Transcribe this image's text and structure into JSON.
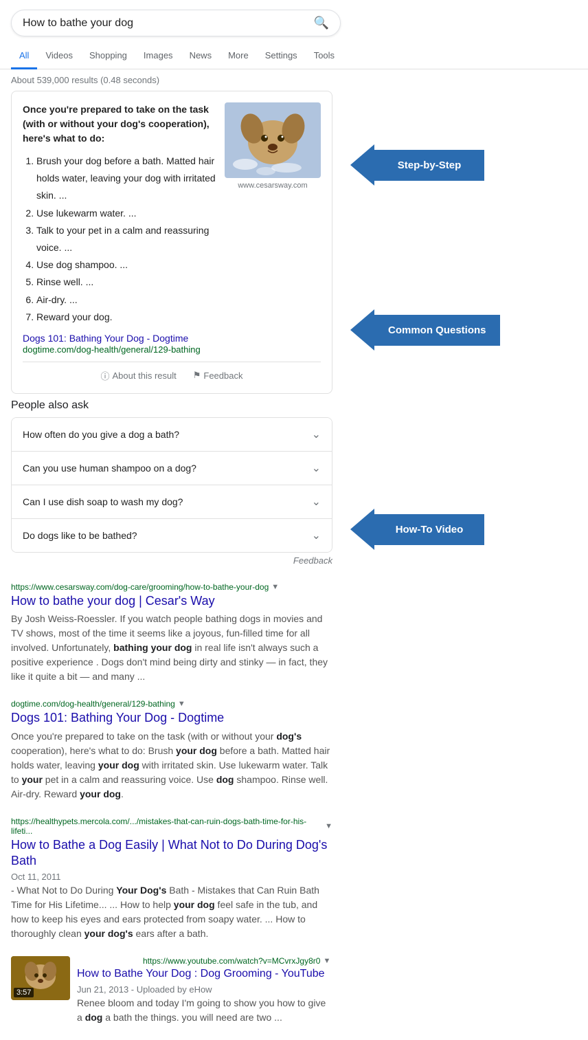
{
  "searchbar": {
    "value": "How to bathe your dog",
    "placeholder": "How to bathe your dog"
  },
  "nav": {
    "tabs": [
      {
        "label": "All",
        "active": true
      },
      {
        "label": "Videos",
        "active": false
      },
      {
        "label": "Shopping",
        "active": false
      },
      {
        "label": "Images",
        "active": false
      },
      {
        "label": "News",
        "active": false
      },
      {
        "label": "More",
        "active": false
      },
      {
        "label": "Settings",
        "active": false
      },
      {
        "label": "Tools",
        "active": false
      }
    ]
  },
  "results_count": "About 539,000 results (0.48 seconds)",
  "featured_snippet": {
    "heading": "Once you're prepared to take on the task (with or without your dog's cooperation), here's what to do:",
    "steps": [
      "Brush your dog before a bath. Matted hair holds water, leaving your dog with irritated skin. ...",
      "Use lukewarm water. ...",
      "Talk to your pet in a calm and reassuring voice. ...",
      "Use dog shampoo. ...",
      "Rinse well. ...",
      "Air-dry. ...",
      "Reward your dog."
    ],
    "image_caption": "www.cesarsway.com",
    "link_title": "Dogs 101: Bathing Your Dog - Dogtime",
    "link_url": "dogtime.com/dog-health/general/129-bathing",
    "about_label": "About this result",
    "feedback_label": "Feedback"
  },
  "paa": {
    "title": "People also ask",
    "items": [
      "How often do you give a dog a bath?",
      "Can you use human shampoo on a dog?",
      "Can I use dish soap to wash my dog?",
      "Do dogs like to be bathed?"
    ],
    "feedback_label": "Feedback"
  },
  "search_results": [
    {
      "title": "How to bathe your dog | Cesar's Way",
      "url": "https://www.cesarsway.com/dog-care/grooming/how-to-bathe-your-dog",
      "short_url": "https://www.cesarsway.com/dog-care/grooming/how-to-bathe-your-dog",
      "description": "By Josh Weiss-Roessler. If you watch people bathing dogs in movies and TV shows, most of the time it seems like a joyous, fun-filled time for all involved. Unfortunately, bathing your dog in real life isn't always such a positive experience . Dogs don't mind being dirty and stinky — in fact, they like it quite a bit — and many ...",
      "bold_words": [
        "bathing your dog"
      ]
    },
    {
      "title": "Dogs 101: Bathing Your Dog - Dogtime",
      "url": "https://dogtime.com/dog-health/general/129-bathing",
      "short_url": "dogtime.com/dog-health/general/129-bathing",
      "description": "Once you're prepared to take on the task (with or without your dog's cooperation), here's what to do: Brush your dog before a bath. Matted hair holds water, leaving your dog with irritated skin. Use lukewarm water. Talk to your pet in a calm and reassuring voice. Use dog shampoo. Rinse well. Air-dry. Reward your dog.",
      "bold_words": [
        "dog's",
        "your dog",
        "your",
        "dog",
        "your dog"
      ]
    },
    {
      "title": "How to Bathe a Dog Easily | What Not to Do During Dog's Bath",
      "url": "https://healthypets.mercola.com/.../mistakes-that-can-ruin-dogs-bath-time-for-his-lifeti...",
      "short_url": "https://healthypets.mercola.com/.../mistakes-that-can-ruin-dogs-bath-time-for-his-lifeti...",
      "date": "Oct 11, 2011",
      "description": "- What Not to Do During Your Dog's Bath - Mistakes that Can Ruin Bath Time for His Lifetime... ... How to help your dog feel safe in the tub, and how to keep his eyes and ears protected from soapy water. ... How to thoroughly clean your dog's ears after a bath.",
      "bold_words": [
        "Your Dog's",
        "your dog",
        "your dog's"
      ]
    }
  ],
  "video_result": {
    "title": "How to Bathe Your Dog : Dog Grooming - YouTube",
    "url": "https://www.youtube.com/watch?v=MCvrxJgy8r0",
    "short_url": "https://www.youtube.com/watch?v=MCvrxJgy8r0",
    "date": "Jun 21, 2013 - Uploaded by eHow",
    "duration": "3:57",
    "description": "Renee bloom and today I'm going to show you how to give a dog a bath the things. you will need are two ..."
  },
  "annotations": {
    "step_by_step": "Step-by-Step",
    "common_questions": "Common Questions",
    "how_to_video": "How-To Video"
  }
}
